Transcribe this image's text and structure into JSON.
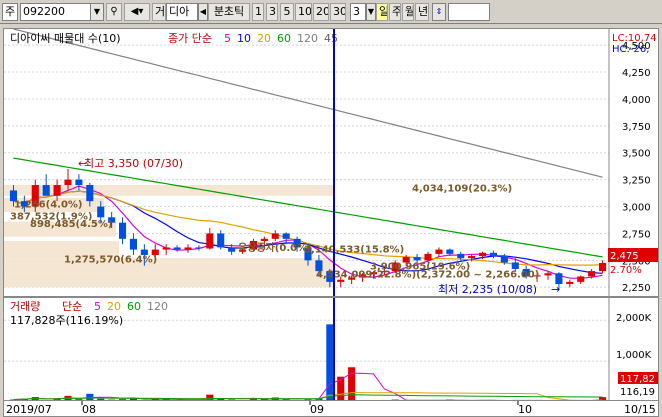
{
  "toolbar": {
    "market": "주",
    "code": "092200",
    "search_icon": "magnifier-icon",
    "sound_icon": "speaker-icon",
    "type_label": "거",
    "name": "디아",
    "split_label": "분초틱",
    "periods": [
      "1",
      "3",
      "5",
      "10",
      "20",
      "30"
    ],
    "period_value": "3",
    "day": "일",
    "week": "주",
    "month": "월",
    "year": "년",
    "count_input": ""
  },
  "price_chart": {
    "title": "디아이씨 매물대 수(10)",
    "ma_label": "종가 단순",
    "ma_periods": [
      "5",
      "10",
      "20",
      "60",
      "120",
      "45"
    ],
    "ma_colors": [
      "#e000e0",
      "#0000ff",
      "#e0a000",
      "#00a000",
      "#808080",
      "#606060"
    ],
    "lc_text": "LC:10,74",
    "hc_text": "HC:-26,",
    "price_ticks": [
      "4,500",
      "4,250",
      "4,000",
      "3,750",
      "3,500",
      "3,250",
      "3,000",
      "2,750",
      "2,500",
      "2,250"
    ],
    "current_price": "2,475",
    "current_pct": "2.70%",
    "high_label": "최고 3,350 (07/30)",
    "low_label": "최저 2,235 (10/08)",
    "vp_labels": [
      "4,034,109(20.3%)",
      "1,266(4.0%)",
      "387,532(1.9%)",
      "898,485(4.5%)",
      "1,275,570(6.4%)",
      "유상증자(0.0%)",
      "3,140,533(15.8%)",
      "3,900,965(19.6%)",
      "4,534,009(22.8%)(2,372.00 ~ 2,266.00)"
    ]
  },
  "volume_chart": {
    "title": "거래량",
    "ma_label": "단순",
    "ma_periods": [
      "5",
      "20",
      "60",
      "120"
    ],
    "ma_colors": [
      "#e000e0",
      "#e0a000",
      "#00a000",
      "#808080"
    ],
    "summary": "117,828주(116.19%)",
    "ticks": [
      "2,000K",
      "1,000K"
    ],
    "current": "117,82",
    "current_pct": "116,19"
  },
  "x_axis": {
    "labels": [
      "2019/07",
      "08",
      "09",
      "10",
      "10/15"
    ]
  },
  "chart_data": {
    "type": "candlestick",
    "ylim": [
      2150,
      4650
    ],
    "candles": [
      [
        3150,
        3200,
        3000,
        3050
      ],
      [
        3050,
        3100,
        2950,
        3000
      ],
      [
        3000,
        3250,
        2950,
        3200
      ],
      [
        3200,
        3300,
        3100,
        3100
      ],
      [
        3100,
        3250,
        3050,
        3200
      ],
      [
        3200,
        3350,
        3150,
        3250
      ],
      [
        3250,
        3300,
        3150,
        3200
      ],
      [
        3200,
        3220,
        3000,
        3050
      ],
      [
        3000,
        3050,
        2850,
        2900
      ],
      [
        2900,
        2950,
        2800,
        2850
      ],
      [
        2850,
        2900,
        2650,
        2700
      ],
      [
        2700,
        2750,
        2550,
        2600
      ],
      [
        2600,
        2650,
        2450,
        2550
      ],
      [
        2550,
        2650,
        2500,
        2600
      ],
      [
        2600,
        2650,
        2550,
        2620
      ],
      [
        2620,
        2640,
        2580,
        2600
      ],
      [
        2600,
        2650,
        2570,
        2620
      ],
      [
        2620,
        2640,
        2590,
        2610
      ],
      [
        2610,
        2800,
        2600,
        2750
      ],
      [
        2750,
        2780,
        2600,
        2620
      ],
      [
        2620,
        2650,
        2550,
        2580
      ],
      [
        2580,
        2620,
        2560,
        2600
      ],
      [
        2600,
        2700,
        2580,
        2680
      ],
      [
        2680,
        2720,
        2600,
        2700
      ],
      [
        2700,
        2780,
        2680,
        2750
      ],
      [
        2750,
        2760,
        2650,
        2700
      ],
      [
        2700,
        2720,
        2580,
        2620
      ],
      [
        2620,
        2650,
        2450,
        2500
      ],
      [
        2500,
        2550,
        2350,
        2400
      ],
      [
        2400,
        2420,
        2250,
        2300
      ],
      [
        2300,
        2350,
        2250,
        2320
      ],
      [
        2320,
        2360,
        2280,
        2340
      ],
      [
        2340,
        2380,
        2300,
        2370
      ],
      [
        2370,
        2400,
        2330,
        2390
      ],
      [
        2390,
        2420,
        2360,
        2400
      ],
      [
        2400,
        2500,
        2380,
        2480
      ],
      [
        2480,
        2550,
        2450,
        2530
      ],
      [
        2530,
        2560,
        2480,
        2500
      ],
      [
        2500,
        2580,
        2480,
        2560
      ],
      [
        2560,
        2620,
        2530,
        2600
      ],
      [
        2600,
        2610,
        2540,
        2560
      ],
      [
        2560,
        2580,
        2500,
        2520
      ],
      [
        2520,
        2560,
        2490,
        2540
      ],
      [
        2540,
        2580,
        2510,
        2570
      ],
      [
        2570,
        2590,
        2520,
        2540
      ],
      [
        2540,
        2560,
        2460,
        2480
      ],
      [
        2480,
        2520,
        2400,
        2420
      ],
      [
        2420,
        2450,
        2330,
        2350
      ],
      [
        2350,
        2380,
        2300,
        2360
      ],
      [
        2360,
        2400,
        2320,
        2380
      ],
      [
        2380,
        2390,
        2235,
        2280
      ],
      [
        2280,
        2320,
        2250,
        2300
      ],
      [
        2300,
        2360,
        2280,
        2350
      ],
      [
        2350,
        2420,
        2330,
        2400
      ],
      [
        2400,
        2500,
        2380,
        2475
      ]
    ],
    "volumes": [
      60,
      80,
      120,
      40,
      90,
      150,
      70,
      200,
      80,
      60,
      70,
      90,
      50,
      80,
      60,
      40,
      30,
      50,
      180,
      90,
      60,
      40,
      90,
      70,
      110,
      60,
      50,
      80,
      90,
      1900,
      620,
      850,
      40,
      30,
      50,
      60,
      45,
      40,
      30,
      35,
      60,
      40,
      30,
      45,
      35,
      30,
      50,
      40,
      35,
      30,
      45,
      40,
      35,
      30,
      118
    ]
  }
}
